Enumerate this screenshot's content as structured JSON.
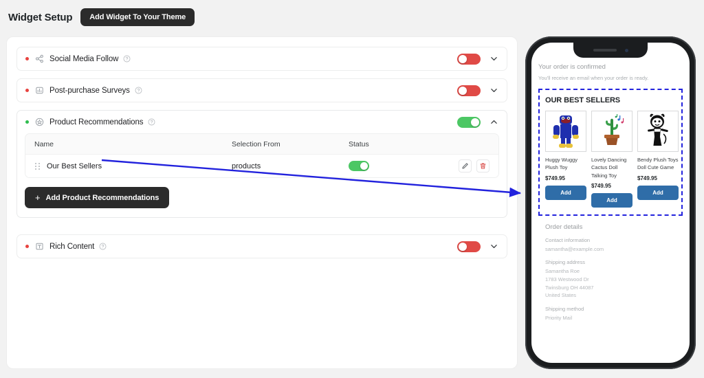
{
  "header": {
    "title": "Widget Setup",
    "add_widget_button": "Add Widget To Your Theme"
  },
  "accordions": [
    {
      "label": "Social Media Follow",
      "status": "inactive",
      "enabled": false,
      "expanded": false,
      "icon": "share-icon"
    },
    {
      "label": "Post-purchase Surveys",
      "status": "inactive",
      "enabled": false,
      "expanded": false,
      "icon": "survey-icon"
    },
    {
      "label": "Product Recommendations",
      "status": "active",
      "enabled": true,
      "expanded": true,
      "icon": "recommendation-icon"
    },
    {
      "label": "Rich Content",
      "status": "inactive",
      "enabled": false,
      "expanded": false,
      "icon": "rich-content-icon"
    }
  ],
  "table": {
    "columns": [
      "Name",
      "Selection From",
      "Status"
    ],
    "rows": [
      {
        "name": "Our Best Sellers",
        "selection_from": "products",
        "status_enabled": true
      }
    ],
    "add_button": "Add Product Recommendations"
  },
  "preview": {
    "order_confirmed_title": "Your order is confirmed",
    "order_confirmed_sub": "You'll receive an email when your order is ready.",
    "widget_title": "OUR BEST SELLERS",
    "products": [
      {
        "name": "Huggy Wuggy Plush Toy",
        "price": "$749.95",
        "add_label": "Add",
        "image": "huggy-wuggy-figure"
      },
      {
        "name": "Lovely Dancing Cactus Doll Talking Toy",
        "price": "$749.95",
        "add_label": "Add",
        "image": "dancing-cactus"
      },
      {
        "name": "Bendy Plush Toys Doll Cute Game",
        "price": "$749.95",
        "add_label": "Add",
        "image": "bendy-character"
      }
    ],
    "order_details": {
      "heading": "Order details",
      "contact_label": "Contact information",
      "contact_value": "samantha@example.com",
      "shipping_address_label": "Shipping address",
      "shipping_address_lines": "Samantha Roe\n1783 Westwood Dr\nTwinsburg OH 44087\nUnited States",
      "shipping_method_label": "Shipping method",
      "shipping_method_value": "Priority Mail"
    }
  },
  "colors": {
    "accent_dark": "#2b2b2b",
    "toggle_on": "#4cc764",
    "toggle_off": "#e04a46",
    "annotation": "#2222dd",
    "add_button": "#2f6da8",
    "status_active": "#2fbd4f",
    "status_inactive": "#e8433f"
  }
}
